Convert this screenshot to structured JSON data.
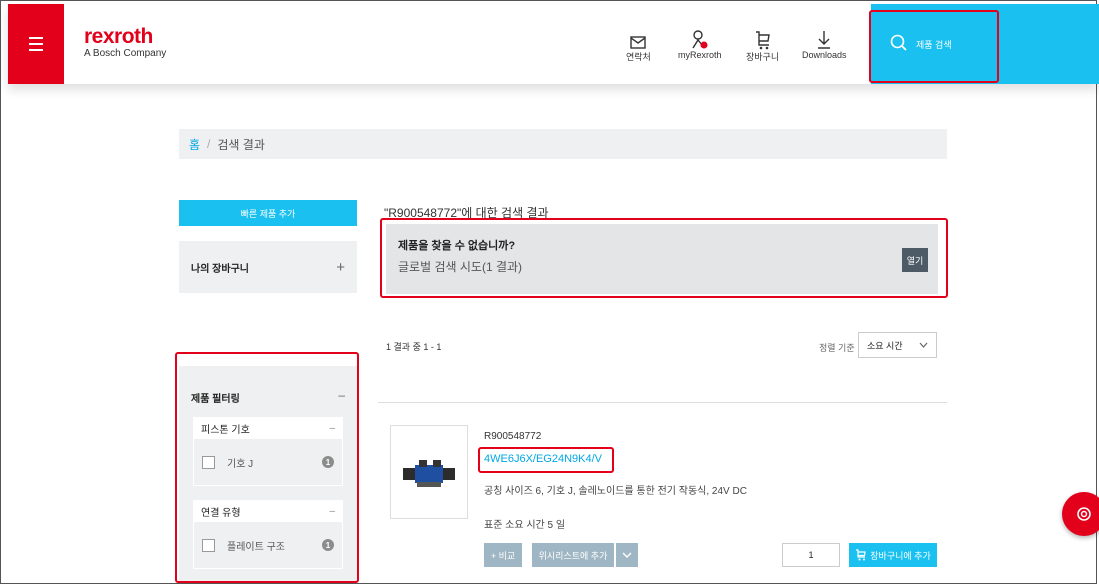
{
  "header": {
    "logo_brand": "rexroth",
    "logo_tagline": "A Bosch Company",
    "nav": [
      {
        "label": "연락처",
        "icon": "mail-icon"
      },
      {
        "label": "myRexroth",
        "icon": "user-icon"
      },
      {
        "label": "장바구니",
        "icon": "cart-icon"
      },
      {
        "label": "Downloads",
        "icon": "download-icon"
      }
    ],
    "search_label": "제품 검색"
  },
  "breadcrumb": {
    "home": "홈",
    "separator": "/",
    "current": "검색 결과"
  },
  "sidebar": {
    "quick_add_label": "빠른 제품 추가",
    "cart_label": "나의 장바구니",
    "cart_toggle": "+",
    "filter_title": "제품 필터링",
    "filter_toggle": "–",
    "groups": [
      {
        "title": "피스톤 기호",
        "toggle": "–",
        "item": "기호 J",
        "count": "1"
      },
      {
        "title": "연결 유형",
        "toggle": "–",
        "item": "플레이트 구조",
        "count": "1"
      }
    ]
  },
  "main": {
    "results_title": "\"R900548772\"에 대한 검색 결과",
    "notfound_title": "제품을 찾을 수 없습니까?",
    "notfound_sub": "글로벌 검색 시도(1 결과)",
    "open_label": "열기",
    "count_text": "1 결과 중 1 - 1",
    "sort_label": "정렬 기준",
    "sort_value": "소요 시간",
    "product": {
      "number": "R900548772",
      "link": "4WE6J6X/EG24N9K4/V",
      "description": "공칭 사이즈 6, 기호 J, 솔레노이드를 통한 전기 작동식, 24V DC",
      "lead_time": "표준 소요 시간 5 일",
      "compare_label": "+ 비교",
      "wishlist_label": "위시리스트에 추가",
      "quantity": "1",
      "add_to_cart_label": "장바구니에 추가"
    }
  },
  "colors": {
    "brand_red": "#e2001a",
    "accent_cyan": "#1ac0f0",
    "link_blue": "#00a8e6"
  }
}
